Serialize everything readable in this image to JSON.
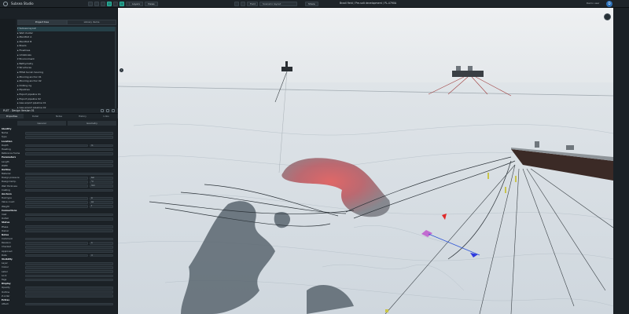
{
  "topbar": {
    "app_title": "Subsea Studio",
    "dropdown_a": "Field",
    "dropdown_b": "Scenario layout",
    "share_label": "Share",
    "project_path": "Brazil field / Pre-salt development / PL-4790A",
    "user_name": "Demo user",
    "avatar_letter": "D",
    "view_btns": [
      "Layers",
      "Views"
    ]
  },
  "left_panel": {
    "tabs": [
      "Project tree",
      "Library items"
    ],
    "tree": [
      "▾ Subsea layout",
      "   ▸ Well cluster",
      "   ▸ Manifold A",
      "   ▸ Manifold B",
      "   ▸ Risers",
      "   ▸ Flowlines",
      "      ▸ Umbilicals",
      "▾ Environment",
      "   ▸ Bathymetry",
      "▾ Structures",
      "   ▸ FPSO turret mooring",
      "      ▸ Mooring anchor 01",
      "      ▸ Mooring anchor 02",
      "   ▸ Drilling rig",
      "▸ Pipelines",
      "   ▸ Export pipeline 01",
      "   ▸ Export pipeline 02",
      "   ▸ Gas export pipeline 01",
      "   ▸ Gas export pipeline 02",
      "   ▸ Water injection line"
    ],
    "props_title": "PLET - Design Version 01",
    "props_tabs": [
      "Properties",
      "Detail",
      "Notes",
      "History",
      "Links"
    ],
    "props_subtabs": [
      "General",
      "Geometry"
    ],
    "props": [
      {
        "label": "Identity",
        "head": true
      },
      {
        "label": "Name",
        "field": true
      },
      {
        "label": "Type",
        "field": true
      },
      {
        "label": "Location",
        "head": true
      },
      {
        "label": "Depth",
        "field": true,
        "half": true,
        "side": "m"
      },
      {
        "label": "Heading",
        "field": true
      },
      {
        "label": "Reference frame",
        "field": true
      },
      {
        "label": "Parameters",
        "head": true
      },
      {
        "label": "Length",
        "field": true
      },
      {
        "label": "Width",
        "field": true
      },
      {
        "label": "Outline",
        "head": true
      },
      {
        "label": "Material",
        "field": true
      },
      {
        "label": "Design pressure",
        "field": true,
        "half": true,
        "side": "bar"
      },
      {
        "label": "Design temp.",
        "field": true,
        "half": true,
        "side": "°C"
      },
      {
        "label": "Wall thickness",
        "field": true,
        "half": true,
        "side": "mm"
      },
      {
        "label": "Coating",
        "field": true
      },
      {
        "label": "Anchors",
        "head": true
      },
      {
        "label": "Hub type",
        "field": true,
        "half": true,
        "side": "in"
      },
      {
        "label": "Valve count",
        "field": true,
        "half": true,
        "side": "ea"
      },
      {
        "label": "Weight",
        "field": true,
        "half": true,
        "side": "t"
      },
      {
        "label": "Connections",
        "head": true
      },
      {
        "label": "Inlet",
        "field": true
      },
      {
        "label": "Outlet",
        "field": true
      },
      {
        "label": "Status",
        "head": true
      },
      {
        "label": "Phase",
        "field": true
      },
      {
        "label": "Owner",
        "field": true
      },
      {
        "label": "Notes",
        "head": true
      },
      {
        "label": "Comment",
        "field": true
      },
      {
        "label": "Revision",
        "field": true,
        "half": true,
        "side": "A"
      },
      {
        "label": "Checked",
        "field": true
      },
      {
        "label": "Approved",
        "field": true
      },
      {
        "label": "Date",
        "field": true,
        "half": true,
        "side": "d"
      },
      {
        "label": "Visibility",
        "head": true
      },
      {
        "label": "Layer",
        "field": true
      },
      {
        "label": "Colour",
        "field": true
      },
      {
        "label": "Label",
        "field": true
      },
      {
        "label": "Lock",
        "field": true
      },
      {
        "label": "Tags",
        "field": true
      },
      {
        "label": "Display",
        "head": true
      },
      {
        "label": "Opacity",
        "field": true
      },
      {
        "label": "Outline",
        "field": true
      },
      {
        "label": "Z-order",
        "field": true
      },
      {
        "label": "Extras",
        "head": true
      },
      {
        "label": "Attach",
        "field": true
      }
    ]
  },
  "viewport": {
    "seabed_color": "#d6dde3",
    "sky_color": "#e8ebee",
    "highlight": "#d84a4a",
    "info_badge": "i"
  }
}
